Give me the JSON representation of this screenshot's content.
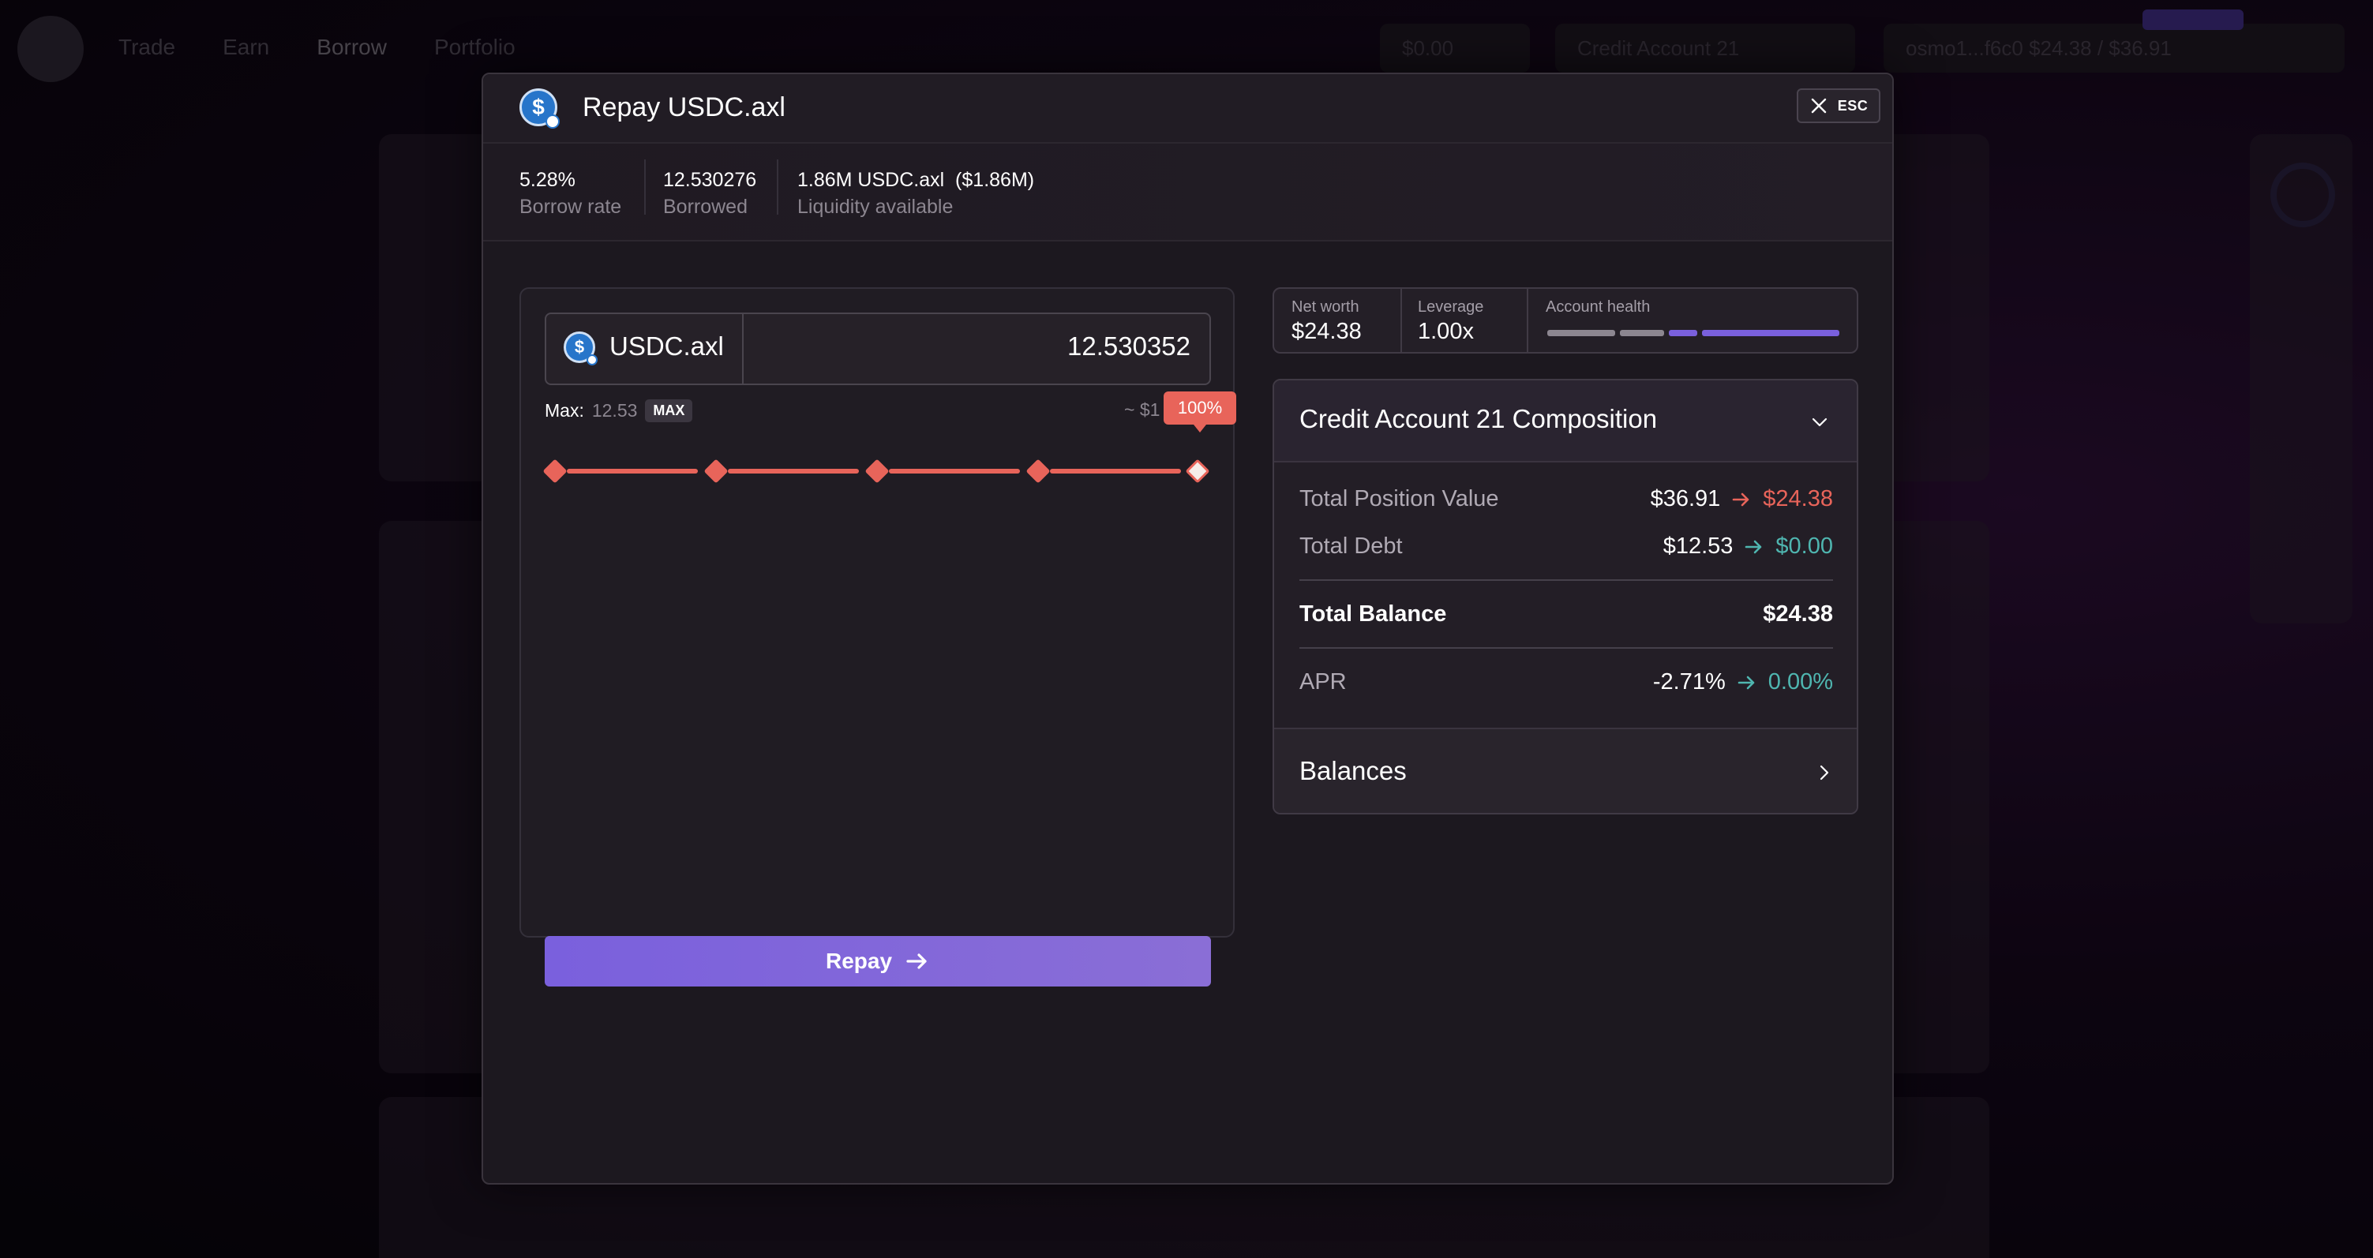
{
  "background": {
    "nav": [
      "Trade",
      "Earn",
      "Borrow",
      "Portfolio"
    ],
    "header_pills": [
      "$0.00",
      "Credit Account 21",
      "osmo1...f6c0  $24.38 / $36.91"
    ]
  },
  "modal": {
    "title": "Repay USDC.axl",
    "close_key": "ESC",
    "stats": [
      {
        "value": "5.28%",
        "label": "Borrow rate"
      },
      {
        "value": "12.530276",
        "label": "Borrowed"
      },
      {
        "value": "1.86M USDC.axl  ($1.86M)",
        "label": "Liquidity available"
      }
    ],
    "input": {
      "asset": "USDC.axl",
      "amount": "12.530352",
      "max_label": "Max:",
      "max_value": "12.53",
      "max_button": "MAX",
      "usd_hint": "~ $1",
      "percent": "100%",
      "percent_fraction": 1.0
    },
    "repay_button": "Repay"
  },
  "summary": {
    "net_worth_label": "Net worth",
    "net_worth": "$24.38",
    "leverage_label": "Leverage",
    "leverage": "1.00x",
    "health_label": "Account health"
  },
  "composition": {
    "title": "Credit Account 21 Composition",
    "rows": [
      {
        "label": "Total Position Value",
        "current": "$36.91",
        "next": "$24.38",
        "trend": "down"
      },
      {
        "label": "Total Debt",
        "current": "$12.53",
        "next": "$0.00",
        "trend": "up"
      }
    ],
    "total_balance_label": "Total Balance",
    "total_balance": "$24.38",
    "apr_label": "APR",
    "apr_current": "-2.71%",
    "apr_next": "0.00%",
    "balances_label": "Balances"
  },
  "colors": {
    "accent": "#7a60dd",
    "danger": "#e8645a",
    "positive": "#4fb6b0"
  }
}
